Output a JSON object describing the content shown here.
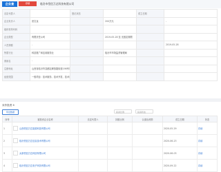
{
  "header": {
    "logo_text": "企业查",
    "tag_text": "存续",
    "title": "临汾市恒信万达科技有限公司"
  },
  "info_rows": [
    [
      {
        "label": "法定代表人",
        "value": ""
      },
      {
        "label": "",
        "value": ""
      },
      {
        "label": "登记状态",
        "value": "存续"
      },
      {
        "label": "",
        "value": ""
      },
      {
        "label": "成立日期",
        "value": "2019-05-28"
      }
    ],
    [
      {
        "label": "企业负责人",
        "value": "张文龙"
      },
      {
        "label": "注册资本",
        "value": "200万元"
      },
      {
        "label": "",
        "value": ""
      },
      {
        "label": "实缴资本",
        "value": "-"
      },
      {
        "label": "",
        "value": ""
      }
    ],
    [
      {
        "label": "组织机构代码",
        "value": ""
      },
      {
        "label": "工商注册号",
        "value": ""
      },
      {
        "label": "",
        "value": ""
      },
      {
        "label": "纳税人识别号",
        "value": ""
      },
      {
        "label": "",
        "value": ""
      }
    ],
    [
      {
        "label": "企业类型",
        "value": "有限责任公司"
      },
      {
        "label": "营业期限",
        "value": "2019-05-28 至 无固定期限"
      },
      {
        "label": "",
        "value": ""
      },
      {
        "label": "纳税人资质",
        "value": ""
      },
      {
        "label": "",
        "value": ""
      }
    ],
    [
      {
        "label": "人员规模",
        "value": "-"
      },
      {
        "label": "",
        "value": ""
      },
      {
        "label": "",
        "value": ""
      },
      {
        "label": "核准日期",
        "value": "2019-05-28"
      },
      {
        "label": "",
        "value": ""
      }
    ],
    [
      {
        "label": "所属行业",
        "value": "科技推广和应用服务业"
      },
      {
        "label": "登记机关",
        "value": "临汾市市场监督管理局"
      },
      {
        "label": "",
        "value": ""
      },
      {
        "label": "",
        "value": ""
      },
      {
        "label": "",
        "value": ""
      }
    ],
    [
      {
        "label": "曾用名",
        "value": "-"
      },
      {
        "label": "",
        "value": ""
      },
      {
        "label": "",
        "value": ""
      },
      {
        "label": "英文名",
        "value": ""
      },
      {
        "label": "",
        "value": ""
      }
    ],
    [
      {
        "label": "注册地址",
        "value": "山西省临汾市尧都区解放路街道198号1幢1单元601室"
      },
      {
        "label": "",
        "value": ""
      },
      {
        "label": "",
        "value": ""
      },
      {
        "label": "",
        "value": ""
      },
      {
        "label": "",
        "value": ""
      }
    ],
    [
      {
        "label": "经营范围",
        "value": "一般项目：技术服务、技术开发、技术咨询、技术交流、技术转让、技术推广；软件开发；信息系统集成服务；信息技术咨询服务"
      },
      {
        "label": "",
        "value": ""
      },
      {
        "label": "",
        "value": ""
      },
      {
        "label": "",
        "value": ""
      },
      {
        "label": "",
        "value": ""
      }
    ]
  ],
  "list_section": {
    "title": "对外投资 6",
    "export_label": "导出数据",
    "filter1": "投资比例",
    "filter2": "投资状态",
    "columns": [
      "序号",
      "被投资企业名称",
      "法定代表人",
      "持股比例",
      "认缴出资额",
      "成立日期",
      "状态"
    ],
    "rows": [
      {
        "index": "1",
        "name": "山西恒信万达能源科技有限公司",
        "rep": "",
        "ratio": "",
        "amount": "",
        "date": "2020-05-29",
        "status": "存续"
      },
      {
        "index": "2",
        "name": "临汾恒信万达信息技术有限公司",
        "rep": "",
        "ratio": "",
        "amount": "",
        "date": "2020-06-23",
        "status": "存续"
      },
      {
        "index": "3",
        "name": "太原恒信万达科技有限公司",
        "rep": "",
        "ratio": "",
        "amount": "",
        "date": "2020-06-03",
        "status": "存续"
      },
      {
        "index": "4",
        "name": "临汾恒信万达电子商务有限公司",
        "rep": "",
        "ratio": "",
        "amount": "",
        "date": "2020-09-22",
        "status": "存续"
      }
    ]
  },
  "colors": {
    "accent_blue": "#3a7bd5",
    "tag_red": "#e2483c",
    "logo_blue": "#1a73d8"
  }
}
